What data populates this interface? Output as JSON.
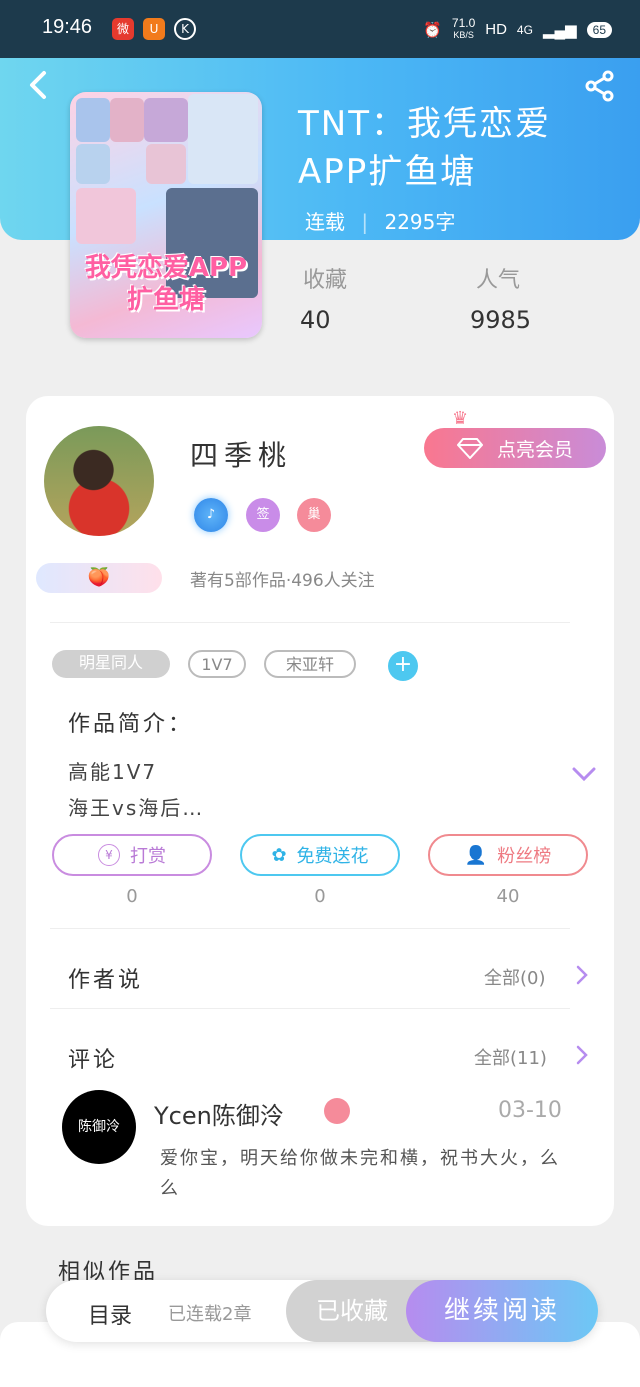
{
  "status_bar": {
    "time": "19:46",
    "net_speed": "71.0",
    "net_unit": "KB/S",
    "hd": "HD",
    "signal": "4G",
    "battery": "65"
  },
  "book": {
    "title": "TNT：我凭恋爱APP扩鱼塘",
    "status": "连载",
    "word_count": "2295字",
    "favorites_label": "收藏",
    "favorites_value": "40",
    "popularity_label": "人气",
    "popularity_value": "9985",
    "cover_text": "我凭恋爱APP扩鱼塘"
  },
  "author": {
    "name": "四季桃",
    "vip_label": "点亮会员",
    "badges": [
      "签",
      "巢"
    ],
    "stats": "著有5部作品·496人关注"
  },
  "tags": [
    "明星同人",
    "1V7",
    "宋亚轩"
  ],
  "intro": {
    "heading": "作品简介：",
    "lines": [
      "高能1V7",
      "海王vs海后…"
    ]
  },
  "actions": [
    {
      "label": "打赏",
      "count": "0",
      "color": "#c98ce0"
    },
    {
      "label": "免费送花",
      "count": "0",
      "color": "#4dc8f0"
    },
    {
      "label": "粉丝榜",
      "count": "40",
      "color": "#f08a8f"
    }
  ],
  "author_says": {
    "heading": "作者说",
    "more": "全部(0)"
  },
  "comments": {
    "heading": "评论",
    "more": "全部(11)",
    "items": [
      {
        "user": "Ycen陈御泠",
        "avatar_text": "陈御泠",
        "date": "03-10",
        "text": "爱你宝，明天给你做未完和横，祝书大火，么么"
      }
    ]
  },
  "similar": {
    "heading": "相似作品"
  },
  "bottom_bar": {
    "toc": "目录",
    "progress": "已连载2章",
    "fav": "已收藏",
    "read": "继续阅读"
  },
  "colors": {
    "header_start": "#6fd6ef",
    "header_end": "#3a9ff0",
    "accent_purple": "#b68cef"
  }
}
